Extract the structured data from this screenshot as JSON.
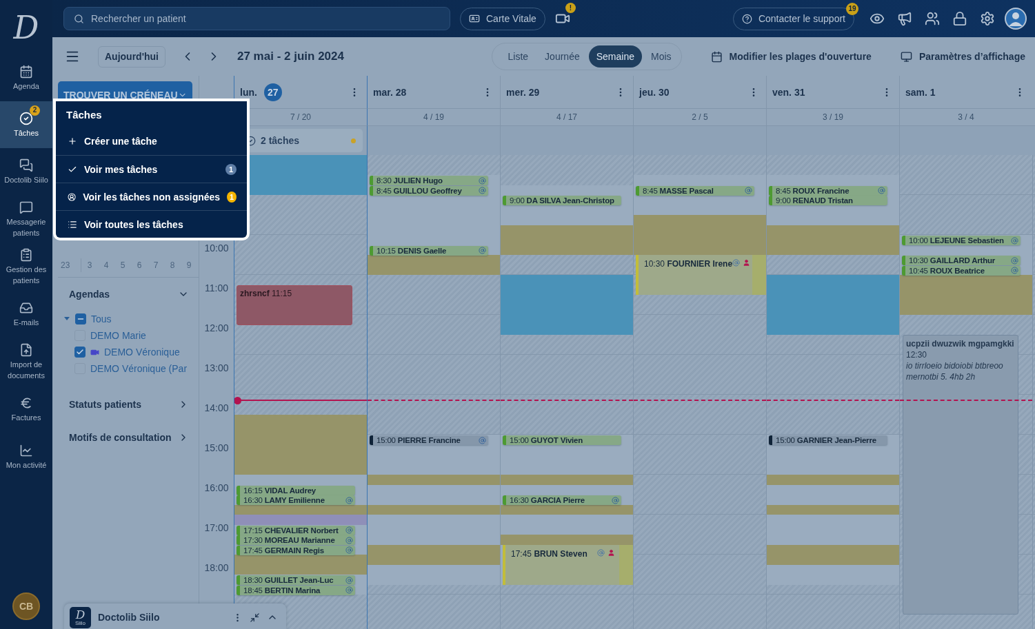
{
  "brand_mark": "D",
  "nav": {
    "items": [
      {
        "label": "Agenda",
        "selected": false
      },
      {
        "label": "Tâches",
        "selected": true,
        "badge": "2"
      },
      {
        "label": "Doctolib Siilo",
        "selected": false
      },
      {
        "label": "Messagerie patients",
        "selected": false
      },
      {
        "label": "Gestion des patients",
        "selected": false
      },
      {
        "label": "E-mails",
        "selected": false
      },
      {
        "label": "Import de documents",
        "selected": false
      },
      {
        "label": "Factures",
        "selected": false
      },
      {
        "label": "Mon activité",
        "selected": false
      }
    ],
    "avatar": "CB"
  },
  "top_bar": {
    "search": {
      "placeholder": "Rechercher un patient"
    },
    "carte_vitale": "Carte Vitale",
    "video_badge": "!",
    "support": {
      "label": "Contacter le support",
      "badge": "19"
    }
  },
  "toolbar": {
    "today_button": "Aujourd'hui",
    "title": "27 mai - 2 juin 2024",
    "views": [
      {
        "label": "Liste",
        "selected": false
      },
      {
        "label": "Journée",
        "selected": false
      },
      {
        "label": "Semaine",
        "selected": true
      },
      {
        "label": "Mois",
        "selected": false
      }
    ],
    "actions": [
      "Modifier les plages d'ouverture",
      "Paramètres d’affichage"
    ]
  },
  "left_panel": {
    "find_slot": "TROUVER UN CRÉNEAU",
    "mini_calendar": {
      "week": "23",
      "days": [
        "3",
        "4",
        "5",
        "6",
        "7",
        "8",
        "9"
      ]
    },
    "agendas": {
      "title": "Agendas",
      "expanded": true,
      "items": [
        {
          "label": "Tous",
          "indeterminate": true,
          "expanded": true,
          "children": [
            {
              "label": "DEMO Marie",
              "checked": false,
              "video": false
            },
            {
              "label": "DEMO Véronique",
              "checked": true,
              "video": true
            },
            {
              "label": "DEMO Véronique (Par",
              "checked": false,
              "video": false
            }
          ]
        }
      ]
    },
    "sections": [
      "Statuts patients",
      "Motifs de consultation"
    ]
  },
  "calendar": {
    "hours": [
      "10:00",
      "11:00",
      "12:00",
      "13:00",
      "14:00",
      "15:00",
      "16:00",
      "17:00",
      "18:00"
    ],
    "days": [
      {
        "weekday": "lun.",
        "date": "27",
        "today": true,
        "count": "7 / 20",
        "tasks": {
          "label": "2 tâches",
          "color": "#c9a227"
        },
        "events": [
          {
            "kind": "block",
            "title": "zhrsncf",
            "time": "11:15"
          },
          {
            "kind": "chip",
            "time": "16:15",
            "name": "VIDAL Audrey",
            "waiting": false,
            "at": false
          },
          {
            "kind": "chip",
            "time": "16:30",
            "name": "LAMY Emilienne",
            "waiting": false,
            "at": true
          },
          {
            "kind": "chip",
            "time": "17:15",
            "name": "CHEVALIER Norbert",
            "waiting": false,
            "at": true
          },
          {
            "kind": "chip",
            "time": "17:30",
            "name": "MOREAU Marianne",
            "waiting": false,
            "at": true
          },
          {
            "kind": "chip",
            "time": "17:45",
            "name": "GERMAIN Regis",
            "waiting": false,
            "at": true
          },
          {
            "kind": "chip",
            "time": "18:30",
            "name": "GUILLET Jean-Luc",
            "waiting": false,
            "at": true
          },
          {
            "kind": "chip",
            "time": "18:45",
            "name": "BERTIN Marina",
            "waiting": false,
            "at": true
          }
        ]
      },
      {
        "weekday": "mar.",
        "date": "28",
        "today": false,
        "count": "4 / 19",
        "events": [
          {
            "kind": "chip",
            "time": "8:30",
            "name": "JULIEN Hugo",
            "waiting": false,
            "at": true
          },
          {
            "kind": "chip",
            "time": "8:45",
            "name": "GUILLOU Geoffrey",
            "waiting": false,
            "at": true
          },
          {
            "kind": "chip",
            "time": "10:15",
            "name": "DENIS Gaelle",
            "waiting": false,
            "at": true
          },
          {
            "kind": "chip",
            "time": "15:00",
            "name": "PIERRE Francine",
            "waiting": true,
            "at": true
          }
        ]
      },
      {
        "weekday": "mer.",
        "date": "29",
        "today": false,
        "count": "4 / 17",
        "events": [
          {
            "kind": "chip",
            "time": "9:00",
            "name": "DA SILVA Jean-Christop",
            "waiting": false,
            "at": false
          },
          {
            "kind": "chip",
            "time": "15:00",
            "name": "GUYOT Vivien",
            "waiting": false,
            "at": false
          },
          {
            "kind": "chip",
            "time": "16:30",
            "name": "GARCIA Pierre",
            "waiting": false,
            "at": true
          },
          {
            "kind": "box",
            "time": "17:45",
            "name": "BRUN Steven",
            "at": true,
            "person": true
          }
        ]
      },
      {
        "weekday": "jeu.",
        "date": "30",
        "today": false,
        "count": "2 / 5",
        "events": [
          {
            "kind": "chip",
            "time": "8:45",
            "name": "MASSE Pascal",
            "waiting": false,
            "at": true
          },
          {
            "kind": "box",
            "time": "10:30",
            "name": "FOURNIER Irene",
            "at": true,
            "person": true
          }
        ]
      },
      {
        "weekday": "ven.",
        "date": "31",
        "today": false,
        "count": "3 / 19",
        "events": [
          {
            "kind": "chip",
            "time": "8:45",
            "name": "ROUX Francine",
            "waiting": false,
            "at": true
          },
          {
            "kind": "chip",
            "time": "9:00",
            "name": "RENAUD Tristan",
            "waiting": false,
            "at": false
          },
          {
            "kind": "chip",
            "time": "15:00",
            "name": "GARNIER Jean-Pierre",
            "waiting": true,
            "at": false
          }
        ]
      },
      {
        "weekday": "sam.",
        "date": "1",
        "today": false,
        "count": "3 / 4",
        "events": [
          {
            "kind": "chip",
            "time": "10:00",
            "name": "LEJEUNE Sebastien",
            "waiting": false,
            "at": true
          },
          {
            "kind": "chip",
            "time": "10:30",
            "name": "GAILLARD Arthur",
            "waiting": false,
            "at": true
          },
          {
            "kind": "chip",
            "time": "10:45",
            "name": "ROUX Beatrice",
            "waiting": false,
            "at": true
          },
          {
            "kind": "note",
            "title": "ucpzii dwuzwik mgpamgkki",
            "time": "12:30",
            "text": "io tirrloeio bidoiobi btbreoo mernotbi 5. 4hb 2h"
          }
        ]
      }
    ]
  },
  "tasks_menu": {
    "title": "Tâches",
    "items": [
      {
        "label": "Créer une tâche"
      },
      {
        "label": "Voir mes tâches",
        "badge": "1",
        "color": "#5f7ea6"
      },
      {
        "label": "Voir les tâches non assignées",
        "badge": "1",
        "color": "#f4b400"
      },
      {
        "label": "Voir toutes les tâches"
      }
    ]
  },
  "siilo": {
    "logo": "D",
    "logo_caption": "Siilo",
    "title": "Doctolib Siilo"
  }
}
